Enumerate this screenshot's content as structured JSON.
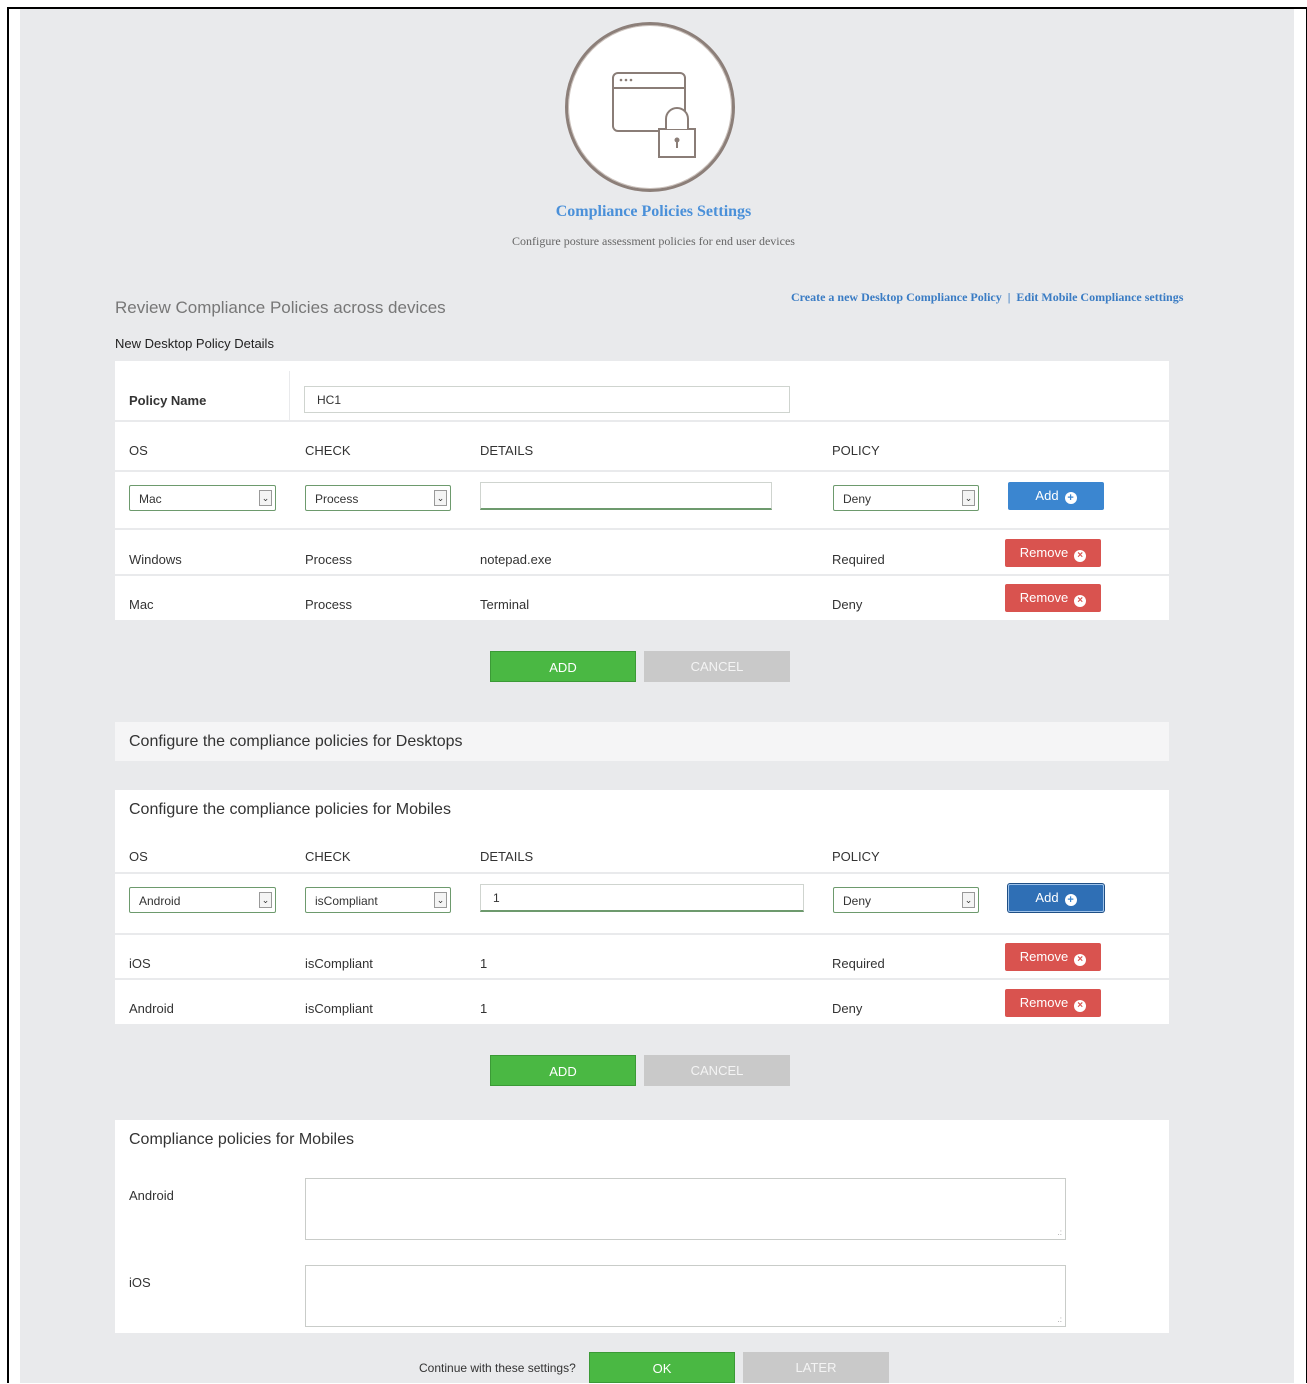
{
  "header": {
    "title": "Compliance Policies Settings",
    "subtitle": "Configure posture assessment policies for end user devices",
    "icon": "window-lock-icon"
  },
  "review_title": "Review Compliance Policies across devices",
  "links": {
    "create_desktop": "Create a new Desktop Compliance Policy",
    "separator": "|",
    "edit_mobile": "Edit Mobile Compliance settings"
  },
  "desktop_policy": {
    "section_label": "New Desktop Policy Details",
    "policy_name_label": "Policy Name",
    "policy_name_value": "HC1",
    "columns": [
      "OS",
      "CHECK",
      "DETAILS",
      "POLICY"
    ],
    "new_row": {
      "os": "Mac",
      "check": "Process",
      "details": "",
      "policy": "Deny",
      "add_label": "Add"
    },
    "rows": [
      {
        "os": "Windows",
        "check": "Process",
        "details": "notepad.exe",
        "policy": "Required",
        "remove_label": "Remove"
      },
      {
        "os": "Mac",
        "check": "Process",
        "details": "Terminal",
        "policy": "Deny",
        "remove_label": "Remove"
      }
    ],
    "add_button": "ADD",
    "cancel_button": "CANCEL"
  },
  "desktop_config_title": "Configure the compliance policies for Desktops",
  "mobile_policy": {
    "title": "Configure the compliance policies for Mobiles",
    "columns": [
      "OS",
      "CHECK",
      "DETAILS",
      "POLICY"
    ],
    "new_row": {
      "os": "Android",
      "check": "isCompliant",
      "details": "1",
      "policy": "Deny",
      "add_label": "Add"
    },
    "rows": [
      {
        "os": "iOS",
        "check": "isCompliant",
        "details": "1",
        "policy": "Required",
        "remove_label": "Remove"
      },
      {
        "os": "Android",
        "check": "isCompliant",
        "details": "1",
        "policy": "Deny",
        "remove_label": "Remove"
      }
    ],
    "add_button": "ADD",
    "cancel_button": "CANCEL"
  },
  "mobile_compliance": {
    "title": "Compliance policies for Mobiles",
    "android_label": "Android",
    "ios_label": "iOS"
  },
  "footer": {
    "question": "Continue with these settings?",
    "ok_button": "OK",
    "later_button": "LATER"
  },
  "colors": {
    "background": "#e9eaec",
    "link_blue": "#3a7cc4",
    "add_blue": "#3b86d0",
    "remove_red": "#d9534f",
    "ok_green": "#4ab843",
    "disabled_grey": "#c9c9c9"
  }
}
